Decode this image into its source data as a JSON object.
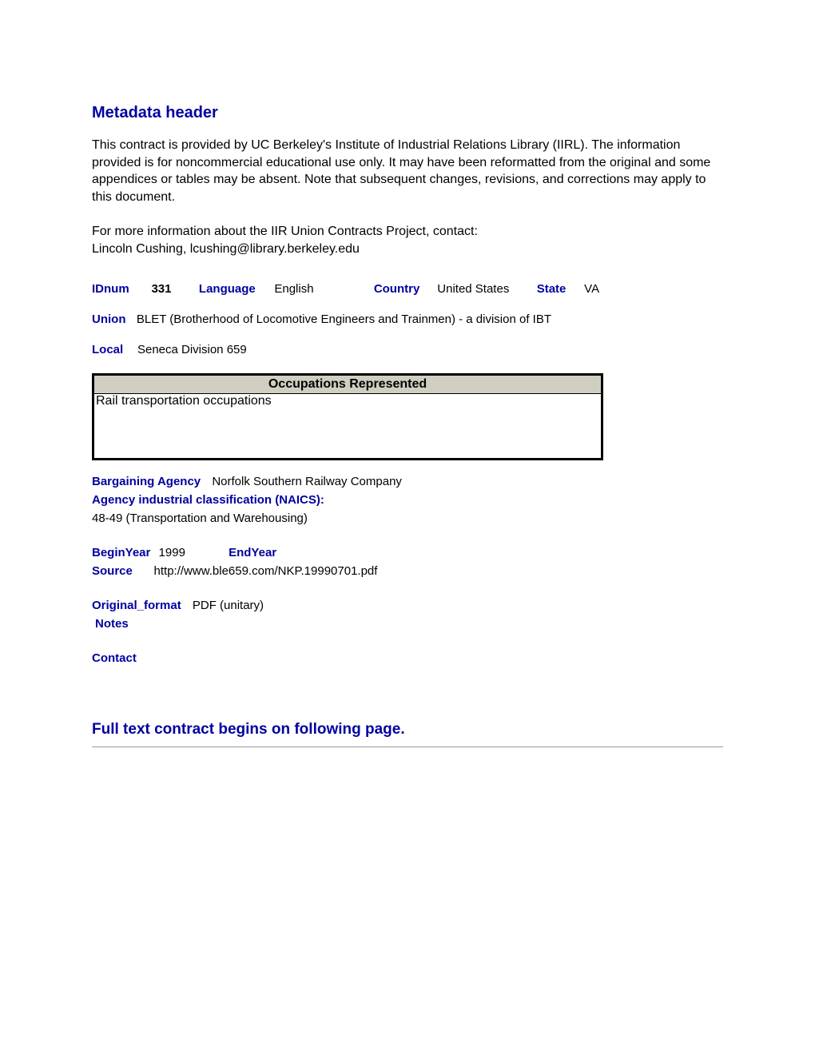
{
  "header": {
    "title": "Metadata header",
    "intro": "This contract is provided by UC Berkeley's Institute of Industrial Relations Library (IIRL). The information provided is for noncommercial educational use only. It may have been reformatted from the original and some appendices or tables may be absent. Note that subsequent changes, revisions, and corrections may apply to this document.",
    "moreinfo_line1": "For more information about the IIR Union Contracts Project, contact:",
    "moreinfo_line2": "Lincoln Cushing, lcushing@library.berkeley.edu"
  },
  "labels": {
    "idnum": "IDnum",
    "language": "Language",
    "country": "Country",
    "state": "State",
    "union": "Union",
    "local": "Local",
    "occ_header": "Occupations Represented",
    "bargaining_agency": "Bargaining Agency",
    "naics": "Agency industrial classification (NAICS):",
    "beginyear": "BeginYear",
    "endyear": "EndYear",
    "source": "Source",
    "original_format": "Original_format",
    "notes": "Notes",
    "contact": "Contact"
  },
  "values": {
    "idnum": "331",
    "language": "English",
    "country": "United States",
    "state": "VA",
    "union": "BLET (Brotherhood of Locomotive Engineers and Trainmen) - a division of IBT",
    "local": "Seneca Division 659",
    "occupations": "Rail transportation occupations",
    "bargaining_agency": "Norfolk Southern Railway Company",
    "naics": "48-49 (Transportation and Warehousing)",
    "beginyear": "1999",
    "endyear": "",
    "source": "http://www.ble659.com/NKP.19990701.pdf",
    "original_format": "PDF (unitary)",
    "notes": "",
    "contact": ""
  },
  "footer": {
    "followup": "Full text contract begins on following page."
  }
}
